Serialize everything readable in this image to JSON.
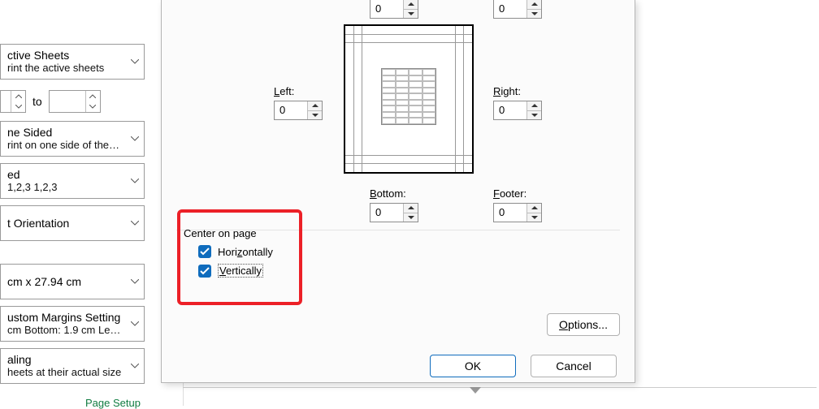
{
  "print_panel": {
    "items": [
      {
        "line1": "ctive Sheets",
        "line2": "rint the active sheets"
      },
      {
        "line1": "ne Sided",
        "line2": "rint on one side of the…"
      },
      {
        "line1": "ed",
        "line2": "1,2,3    1,2,3"
      },
      {
        "line1": "t Orientation",
        "line2": ""
      },
      {
        "line1": "cm x 27.94 cm",
        "line2": ""
      },
      {
        "line1": "ustom Margins Setting",
        "line2": "cm Bottom: 1.9 cm Le…"
      },
      {
        "line1": "aling",
        "line2": "heets at their actual size"
      }
    ],
    "to_label": "to",
    "page_setup_link": "Page Setup"
  },
  "dialog": {
    "top_left_value": "0",
    "top_right_value": "0",
    "left_label": "Left:",
    "left_value": "0",
    "right_label": "Right:",
    "right_value": "0",
    "bottom_label": "Bottom:",
    "bottom_value": "0",
    "footer_label": "Footer:",
    "footer_value": "0",
    "center_title": "Center on page",
    "horiz_label": "Horizontally",
    "vert_label": "Vertically",
    "options_label": "Options...",
    "ok_label": "OK",
    "cancel_label": "Cancel"
  }
}
